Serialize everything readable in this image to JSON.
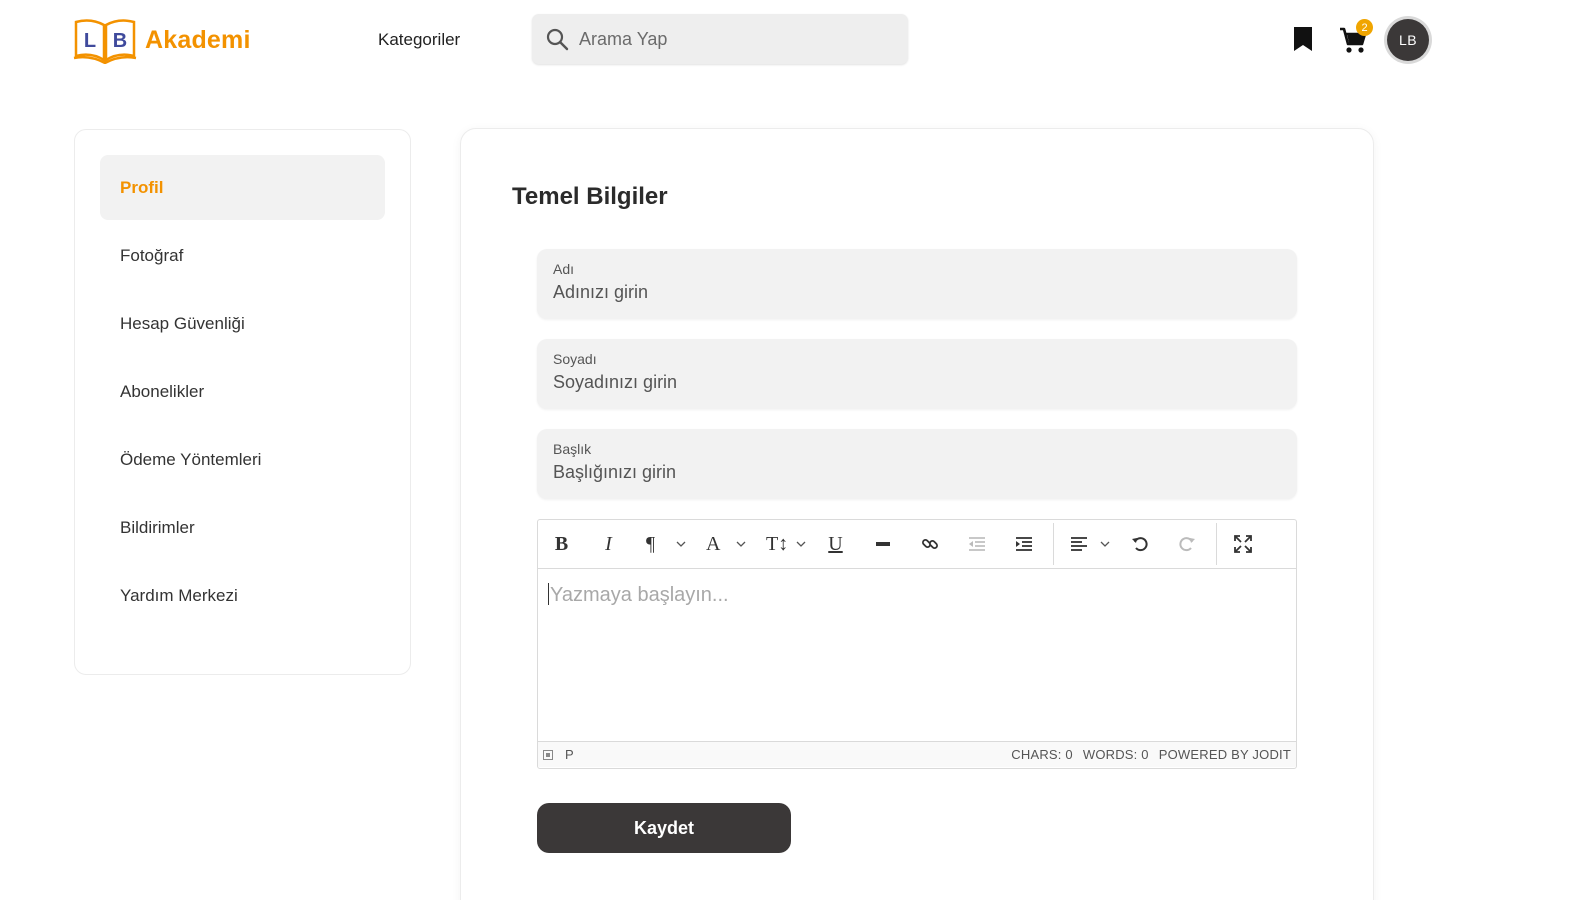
{
  "header": {
    "logo_letters": [
      "L",
      "B"
    ],
    "logo_text": "Akademi",
    "nav_categories": "Kategoriler",
    "search_placeholder": "Arama Yap",
    "cart_count": "2",
    "avatar_initials": "LB",
    "brand_color": "#f39200"
  },
  "sidebar": {
    "items": [
      {
        "label": "Profil",
        "active": true
      },
      {
        "label": "Fotoğraf"
      },
      {
        "label": "Hesap Güvenliği"
      },
      {
        "label": "Abonelikler"
      },
      {
        "label": "Ödeme Yöntemleri"
      },
      {
        "label": "Bildirimler"
      },
      {
        "label": "Yardım Merkezi"
      }
    ]
  },
  "main": {
    "title": "Temel Bilgiler",
    "fields": [
      {
        "label": "Adı",
        "placeholder": "Adınızı girin",
        "value": ""
      },
      {
        "label": "Soyadı",
        "placeholder": "Soyadınızı girin",
        "value": ""
      },
      {
        "label": "Başlık",
        "placeholder": "Başlığınızı girin",
        "value": ""
      }
    ],
    "editor": {
      "placeholder": "Yazmaya başlayın...",
      "toolbar": [
        "bold-icon",
        "italic-icon",
        "paragraph-icon",
        "font-icon",
        "font-size-icon",
        "underline-icon",
        "horizontal-rule-icon",
        "link-icon",
        "outdent-icon",
        "indent-icon",
        "align-icon",
        "undo-icon",
        "redo-icon",
        "fullscreen-icon"
      ],
      "status_path": "P",
      "chars": "CHARS: 0",
      "words": "WORDS: 0",
      "powered": "POWERED BY JODIT"
    },
    "save_label": "Kaydet"
  }
}
